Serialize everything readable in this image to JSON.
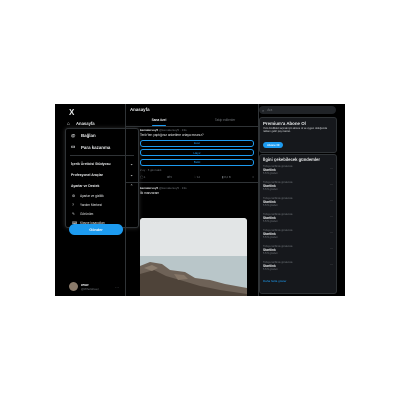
{
  "logo": "X",
  "nav": {
    "home": "Anasayfa",
    "home_icon": "house-icon"
  },
  "menu": {
    "items": [
      {
        "label": "Bağlan",
        "icon": "at-icon"
      },
      {
        "label": "Para kazanma",
        "icon": "money-icon"
      }
    ],
    "sections": [
      {
        "label": "İçerik Üreticisi Stüdyosu"
      },
      {
        "label": "Profesyonel Araçlar"
      },
      {
        "label": "Ayarlar ve Destek"
      }
    ],
    "subitems": [
      {
        "label": "Ayarlar ve gizlilik",
        "icon": "gear-icon"
      },
      {
        "label": "Yardım Merkezi",
        "icon": "help-icon"
      },
      {
        "label": "Görünüm",
        "icon": "brush-icon"
      },
      {
        "label": "Klavye kısayolları",
        "icon": "keyboard-icon"
      }
    ]
  },
  "post_button": "Gönder",
  "profile": {
    "name": "www",
    "handle": "@WhoIsFeel"
  },
  "center": {
    "title": "Anasayfa",
    "tabs": [
      "Sana özel",
      "Takip edilenler"
    ],
    "poll_post": {
      "author": "kemalersoy5",
      "handle": "@kemalersoy5 · 13s",
      "text": "Terör'ten yaptığınız anketlere ortaya mısınız?",
      "options": [
        "Evet",
        "Hayır",
        "Belki"
      ],
      "meta": "2 oy · 5 gün kaldı",
      "actions": [
        "1",
        "5",
        "12",
        "8,2 B"
      ]
    },
    "photo_post": {
      "author": "kemalersoy5",
      "handle": "@kemalersoy5 · 13s",
      "caption": "İlk manzaram"
    }
  },
  "right": {
    "search_placeholder": "Ara",
    "premium": {
      "title": "Premium'a Abone Ol",
      "body": "Yeni özellikleri açmak için abone ol ve uygun olduğunda reklam geliri payı kazan.",
      "button": "Abone Ol"
    },
    "trends_title": "İlgini çekebilecek gündemler",
    "trends": [
      {
        "category": "Türkiye tarihinde gündemde",
        "name": "Startlink",
        "count": "5.572 gönderi"
      },
      {
        "category": "Türkiye tarihinde gündemde",
        "name": "Startlink",
        "count": "5.572 gönderi"
      },
      {
        "category": "Türkiye tarihinde gündemde",
        "name": "Startlink",
        "count": "5.572 gönderi"
      },
      {
        "category": "Türkiye tarihinde gündemde",
        "name": "Startlink",
        "count": "5.572 gönderi"
      },
      {
        "category": "Türkiye tarihinde gündemde",
        "name": "Startlink",
        "count": "5.572 gönderi"
      },
      {
        "category": "Türkiye tarihinde gündemde",
        "name": "Startlink",
        "count": "5.572 gönderi"
      },
      {
        "category": "Türkiye tarihinde gündemde",
        "name": "Startlink",
        "count": "5.572 gönderi"
      }
    ],
    "show_more": "Daha fazla göster"
  },
  "colors": {
    "accent": "#1d9bf0",
    "background": "#000000",
    "border": "#2f3336"
  }
}
